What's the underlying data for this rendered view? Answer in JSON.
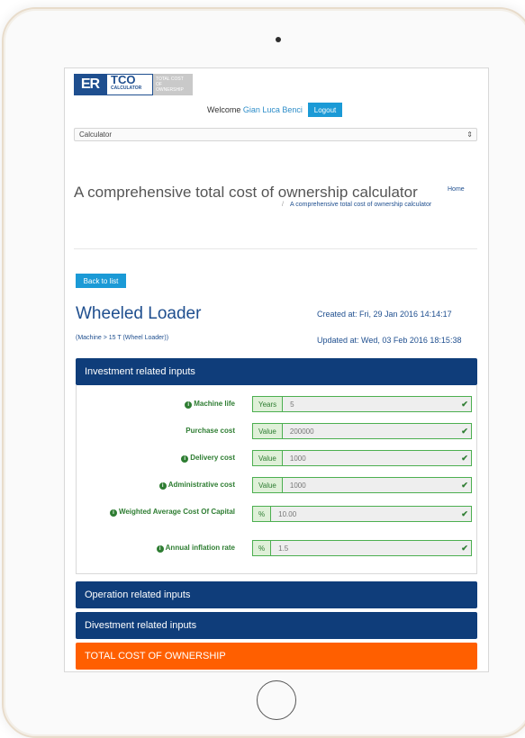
{
  "header": {
    "logo_er": "ER",
    "logo_tco": "TCO",
    "logo_tco_sub": "CALCULATOR",
    "logo_side": "TOTAL COST OF OWNERSHIP",
    "welcome_label": "Welcome",
    "user_name": "Gian Luca Benci",
    "logout_label": "Logout"
  },
  "nav": {
    "selected": "Calculator"
  },
  "page": {
    "title": "A comprehensive total cost of ownership calculator",
    "breadcrumb_home": "Home",
    "breadcrumb_sep": "/",
    "breadcrumb_current": "A comprehensive total cost of ownership calculator"
  },
  "detail": {
    "back_label": "Back to list",
    "machine_title": "Wheeled Loader",
    "machine_sub": "(Machine > 15 T (Wheel Loader))",
    "created": "Created at: Fri, 29 Jan 2016 14:14:17",
    "updated": "Updated at: Wed, 03 Feb 2016 18:15:38"
  },
  "investment": {
    "heading": "Investment related inputs",
    "rows": [
      {
        "label": "Machine life",
        "info": true,
        "addon": "Years",
        "value": "5"
      },
      {
        "label": "Purchase cost",
        "info": false,
        "addon": "Value",
        "value": "200000"
      },
      {
        "label": "Delivery cost",
        "info": true,
        "addon": "Value",
        "value": "1000"
      },
      {
        "label": "Administrative cost",
        "info": true,
        "addon": "Value",
        "value": "1000"
      },
      {
        "label": "Weighted Average Cost Of Capital",
        "info": true,
        "addon": "%",
        "value": "10.00"
      },
      {
        "label": "Annual inflation rate",
        "info": true,
        "addon": "%",
        "value": "1.5"
      }
    ]
  },
  "sections": {
    "operation": "Operation related inputs",
    "divestment": "Divestment related inputs",
    "total": "TOTAL COST OF OWNERSHIP"
  },
  "icons": {
    "info": "info-icon",
    "check": "check-icon",
    "select_arrows": "select-arrows-icon"
  },
  "colors": {
    "primary": "#0f3d7a",
    "accent": "#1b9ad6",
    "total": "#ff5f00",
    "success": "#2e7d32"
  }
}
